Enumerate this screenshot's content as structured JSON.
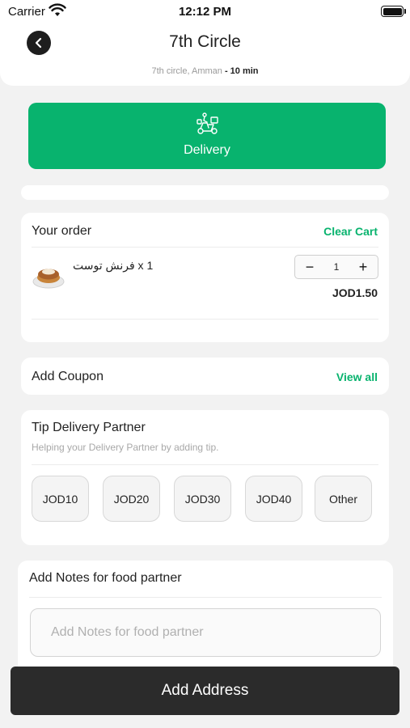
{
  "status_bar": {
    "carrier": "Carrier",
    "time": "12:12 PM"
  },
  "header": {
    "title": "7th Circle",
    "location": "7th circle, Amman",
    "separator": " - ",
    "eta": "10 min"
  },
  "delivery_mode": {
    "label": "Delivery",
    "icon": "delivery-scooter-icon"
  },
  "order": {
    "title": "Your order",
    "clear_label": "Clear Cart",
    "items": [
      {
        "name": "فرنش توست x 1",
        "quantity": "1",
        "price": "JOD1.50",
        "minus": "−",
        "plus": "+"
      }
    ]
  },
  "coupon": {
    "title": "Add Coupon",
    "view_all_label": "View all"
  },
  "tip": {
    "title": "Tip Delivery Partner",
    "subtitle": "Helping your Delivery Partner by adding tip.",
    "options": [
      "JOD10",
      "JOD20",
      "JOD30",
      "JOD40",
      "Other"
    ]
  },
  "notes": {
    "title": "Add Notes for food partner",
    "placeholder": "Add Notes for food partner"
  },
  "footer": {
    "button_label": "Add Address"
  },
  "colors": {
    "accent": "#08b36e",
    "dark": "#2b2b2b",
    "background": "#f2f2f2"
  }
}
